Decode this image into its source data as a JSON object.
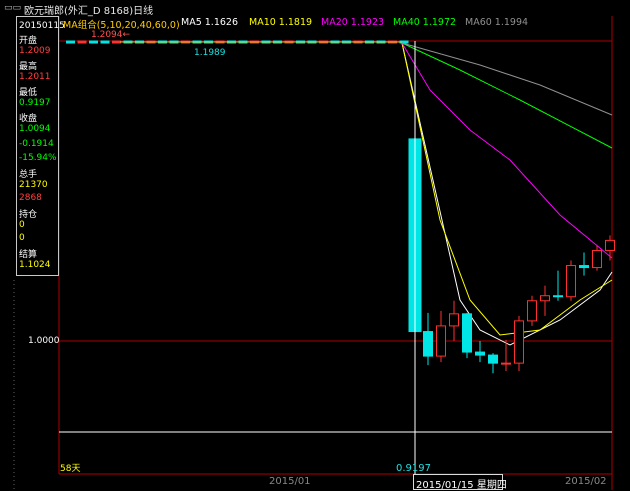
{
  "window": {
    "controls": "▭▭",
    "title": "欧元瑞郎(外汇_D 8168)日线"
  },
  "info_panel": {
    "date": "20150115",
    "open_label": "开盘",
    "open": "1.2009",
    "high_label": "最高",
    "high": "1.2011",
    "low_label": "最低",
    "low": "0.9197",
    "close_label": "收盘",
    "close": "1.0094",
    "change": "-0.1914",
    "change_pct": "-15.94%",
    "volume_label": "总手",
    "volume": "21370",
    "amount": "2868",
    "position_label": "持仓",
    "position": "0",
    "position_change": "0",
    "settle_label": "结算",
    "settle": "1.1024"
  },
  "ma_legend": {
    "group": "MA组合(5,10,20,40,60,0)",
    "ma5": "MA5 1.1626",
    "ma10": "MA10 1.1819",
    "ma20": "MA20 1.1923",
    "ma40": "MA40 1.1972",
    "ma60": "MA60 1.1994"
  },
  "chart_labels": {
    "peak": "1.2094",
    "peak_arrow": "←",
    "level": "1.1989",
    "y_tick": "1.0000",
    "cursor_low": "0.9197",
    "days": "58天",
    "x_tick_1": "2015/01",
    "x_tick_2": "2015/02",
    "cursor_date": "2015/01/15 星期四"
  },
  "colors": {
    "up": "#ff3030",
    "down": "#00e6e6",
    "ma5": "#ffffff",
    "ma10": "#ffff00",
    "ma20": "#ff00ff",
    "ma40": "#00ff00",
    "ma60": "#909090",
    "frame": "#b00000"
  },
  "chart_data": {
    "type": "candlestick",
    "title": "欧元瑞郎(外汇_D 8168)日线",
    "x_range": [
      "2014-11",
      "2015-02"
    ],
    "ylim": [
      0.9,
      1.21
    ],
    "y_ticks": [
      1.0
    ],
    "x_ticks": [
      "2015/01",
      "2015/02"
    ],
    "grid": false,
    "cursor": {
      "date": "2015/01/15",
      "weekday": "星期四",
      "low": 0.9197
    },
    "series": [
      {
        "name": "MA5",
        "value": 1.1626
      },
      {
        "name": "MA10",
        "value": 1.1819
      },
      {
        "name": "MA20",
        "value": 1.1923
      },
      {
        "name": "MA40",
        "value": 1.1972
      },
      {
        "name": "MA60",
        "value": 1.1994
      }
    ],
    "annotations": [
      {
        "text": "1.2094",
        "kind": "period high"
      },
      {
        "text": "1.1989",
        "kind": "level"
      },
      {
        "text": "0.9197",
        "kind": "cursor low"
      }
    ],
    "candles": [
      {
        "o": 1.2009,
        "h": 1.2011,
        "l": 0.9197,
        "c": 1.0094,
        "date": "2015/01/15"
      },
      {
        "o": 1.0094,
        "h": 1.028,
        "l": 0.976,
        "c": 0.985
      },
      {
        "o": 0.985,
        "h": 1.03,
        "l": 0.979,
        "c": 1.015
      },
      {
        "o": 1.015,
        "h": 1.04,
        "l": 1.0,
        "c": 1.027
      },
      {
        "o": 1.027,
        "h": 1.028,
        "l": 0.983,
        "c": 0.989
      },
      {
        "o": 0.989,
        "h": 1.0,
        "l": 0.979,
        "c": 0.986
      },
      {
        "o": 0.986,
        "h": 0.988,
        "l": 0.968,
        "c": 0.978
      },
      {
        "o": 0.978,
        "h": 1.001,
        "l": 0.97,
        "c": 0.978
      },
      {
        "o": 0.978,
        "h": 1.025,
        "l": 0.97,
        "c": 1.02
      },
      {
        "o": 1.02,
        "h": 1.045,
        "l": 1.015,
        "c": 1.04
      },
      {
        "o": 1.04,
        "h": 1.055,
        "l": 1.025,
        "c": 1.045
      },
      {
        "o": 1.045,
        "h": 1.07,
        "l": 1.04,
        "c": 1.044
      },
      {
        "o": 1.044,
        "h": 1.08,
        "l": 1.04,
        "c": 1.075
      },
      {
        "o": 1.075,
        "h": 1.088,
        "l": 1.065,
        "c": 1.073
      },
      {
        "o": 1.073,
        "h": 1.095,
        "l": 1.07,
        "c": 1.09
      },
      {
        "o": 1.09,
        "h": 1.105,
        "l": 1.08,
        "c": 1.1
      },
      {
        "o": 1.1,
        "h": 1.115,
        "l": 1.095,
        "c": 1.105
      },
      {
        "o": 1.105,
        "h": 1.108,
        "l": 1.086,
        "c": 1.095
      }
    ]
  }
}
